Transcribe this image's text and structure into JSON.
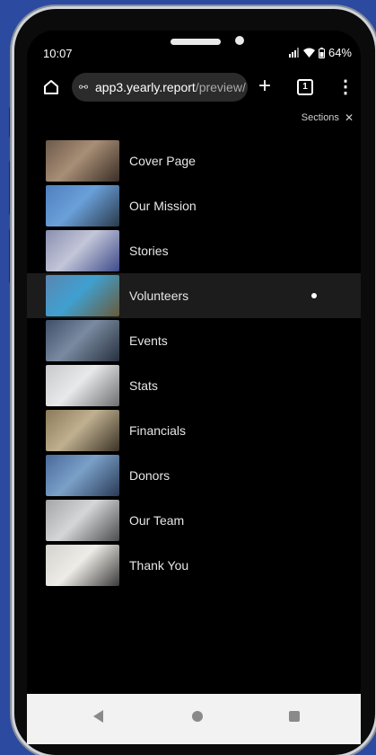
{
  "status": {
    "time": "10:07",
    "battery": "64%"
  },
  "browser": {
    "url_domain": "app3.yearly.report",
    "url_path": "/preview/",
    "tab_count": "1"
  },
  "sections_panel": {
    "title": "Sections",
    "close": "✕"
  },
  "sections": [
    {
      "label": "Cover Page",
      "colors": [
        "#6d5a4a",
        "#a88e76",
        "#3a2e26"
      ]
    },
    {
      "label": "Our Mission",
      "colors": [
        "#4f7fbf",
        "#6aa0da",
        "#2a3a4a"
      ]
    },
    {
      "label": "Stories",
      "colors": [
        "#8a8fb0",
        "#c3c6d8",
        "#3d4a8a"
      ]
    },
    {
      "label": "Volunteers",
      "colors": [
        "#5a86b2",
        "#3fa0d0",
        "#6a5a3a"
      ]
    },
    {
      "label": "Events",
      "colors": [
        "#40506a",
        "#7a8aa0",
        "#26303e"
      ]
    },
    {
      "label": "Stats",
      "colors": [
        "#c7c9cc",
        "#e8e9ea",
        "#6d6e70"
      ]
    },
    {
      "label": "Financials",
      "colors": [
        "#8a7a5a",
        "#c0b090",
        "#3a3226"
      ]
    },
    {
      "label": "Donors",
      "colors": [
        "#4a6a9a",
        "#7aa0c8",
        "#2a3a56"
      ]
    },
    {
      "label": "Our Team",
      "colors": [
        "#a4a6a8",
        "#d4d6d8",
        "#4a4c4e"
      ]
    },
    {
      "label": "Thank You",
      "colors": [
        "#d4d2cc",
        "#eeece6",
        "#3a3a3a"
      ]
    }
  ],
  "active_index": 3
}
